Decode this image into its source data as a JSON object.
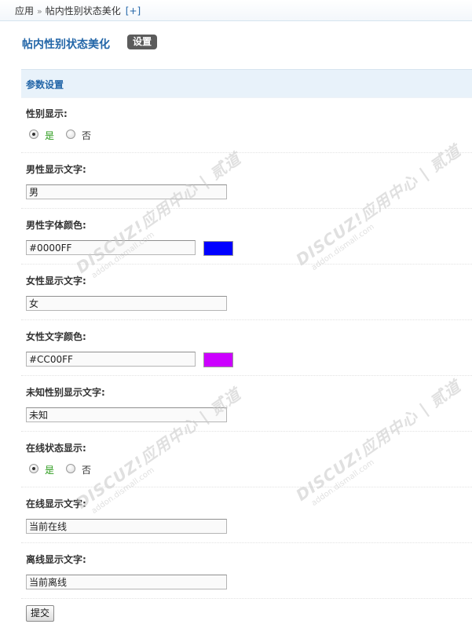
{
  "breadcrumb": {
    "root": "应用",
    "separator": "»",
    "current": "帖内性别状态美化",
    "add": "[+]"
  },
  "header": {
    "title": "帖内性别状态美化",
    "settings_button": "设置"
  },
  "section": {
    "title": "参数设置"
  },
  "fields": {
    "gender_display": {
      "label": "性别显示:",
      "options": [
        "是",
        "否"
      ],
      "selected": "是"
    },
    "male_text": {
      "label": "男性显示文字:",
      "value": "男"
    },
    "male_color": {
      "label": "男性字体颜色:",
      "value": "#0000FF",
      "swatch": "#0000FF"
    },
    "female_text": {
      "label": "女性显示文字:",
      "value": "女"
    },
    "female_color": {
      "label": "女性文字颜色:",
      "value": "#CC00FF",
      "swatch": "#CC00FF"
    },
    "unknown_text": {
      "label": "未知性别显示文字:",
      "value": "未知"
    },
    "online_display": {
      "label": "在线状态显示:",
      "options": [
        "是",
        "否"
      ],
      "selected": "是"
    },
    "online_text": {
      "label": "在线显示文字:",
      "value": "当前在线"
    },
    "offline_text": {
      "label": "离线显示文字:",
      "value": "当前离线"
    }
  },
  "submit": {
    "label": "提交"
  },
  "watermark": {
    "brand": "DISCUZ!应用中心 | 贰道",
    "url": "addon.dismall.com"
  }
}
